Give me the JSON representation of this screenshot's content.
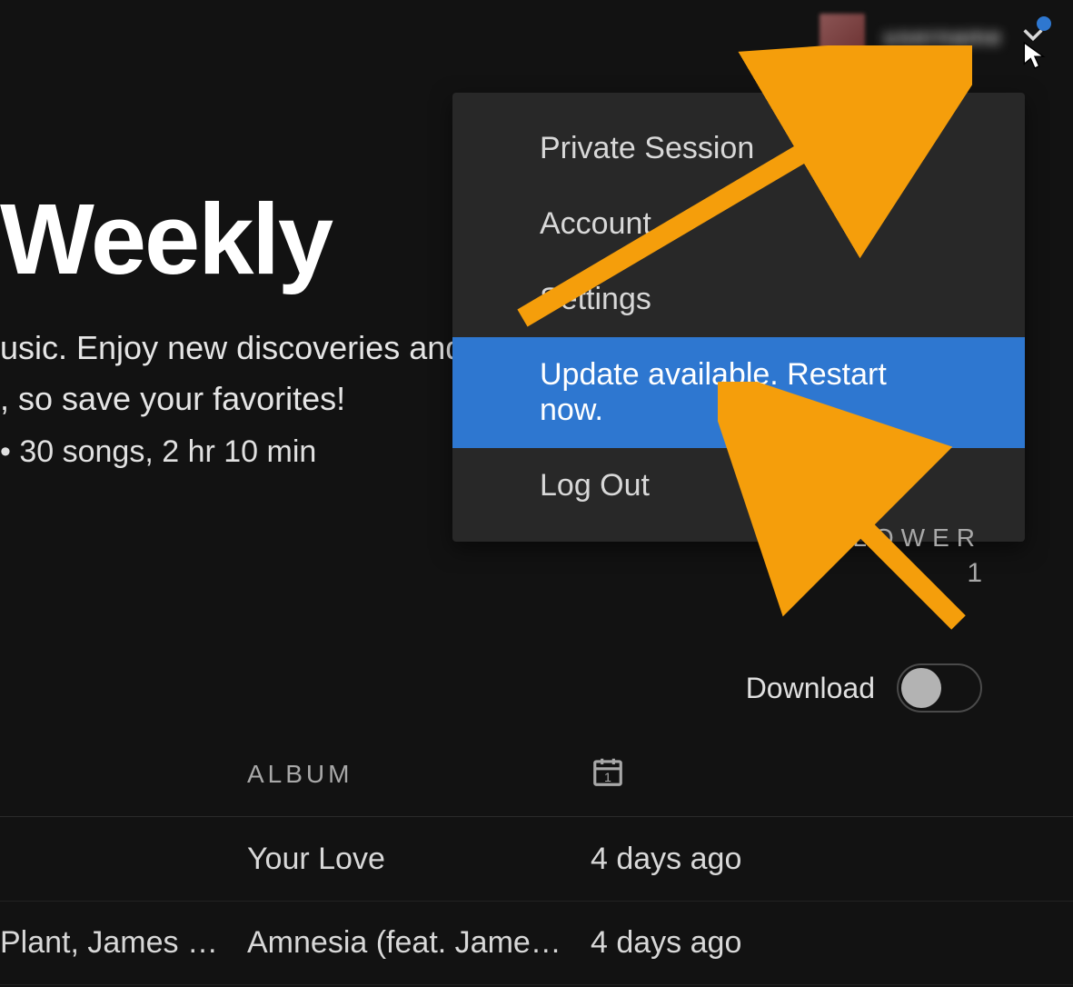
{
  "header": {
    "username_obscured": "username",
    "has_notification": true
  },
  "playlist": {
    "title_fragment": "Weekly",
    "subtitle_line1": "usic. Enjoy new discoveries and",
    "subtitle_line2": ", so save your favorites!",
    "meta": "• 30 songs, 2 hr 10 min"
  },
  "dropdown": {
    "items": [
      {
        "label": "Private Session",
        "highlighted": false
      },
      {
        "label": "Account",
        "highlighted": false
      },
      {
        "label": "Settings",
        "highlighted": false
      },
      {
        "label": "Update available. Restart now.",
        "highlighted": true
      },
      {
        "label": "Log Out",
        "highlighted": false
      }
    ]
  },
  "follower": {
    "label": "FOLLOWER",
    "count": "1"
  },
  "download": {
    "label": "Download",
    "enabled": false
  },
  "table": {
    "album_header": "ALBUM",
    "rows": [
      {
        "artist": "",
        "album": "Your Love",
        "date": "4 days ago"
      },
      {
        "artist": "Plant, James …",
        "album": "Amnesia (feat. Jame…",
        "date": "4 days ago"
      }
    ]
  },
  "annotation": {
    "arrow_color": "#f59e0b"
  }
}
